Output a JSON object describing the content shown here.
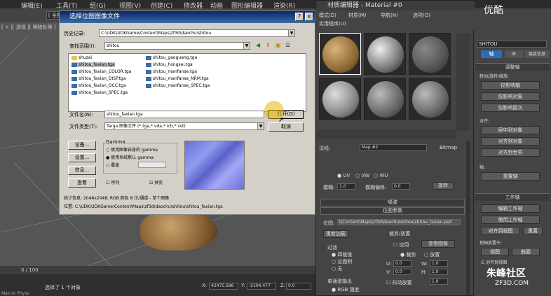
{
  "menubar": {
    "items": [
      "编辑(E)",
      "工具(T)",
      "组(G)",
      "视图(V)",
      "创建(C)",
      "修改器",
      "动画",
      "图形编辑器",
      "渲染(R)"
    ]
  },
  "viewport": {
    "label_top": "[ + ][ 透视 ][ 明暗处理 ]",
    "view_label": "[ 全部"
  },
  "timeline": {
    "frame": "0 / 100"
  },
  "status": {
    "selection": "选择了 1 个对象",
    "x": "42475.586",
    "y": "-2104.477",
    "z": "0.0",
    "prompt": "Max to Physx"
  },
  "file_dialog": {
    "title": "选择位图图像文件",
    "history_label": "历史记录:",
    "history_value": "C:\\UDK\\UDKGame\\Content\\Maps\\zf3d\\daochu\\shitou",
    "lookin_label": "查找范围(I):",
    "lookin_value": "shitou",
    "files_col1": [
      "shuzai",
      "shitou_faxian.tga",
      "shitou_faxian_COLOR.tga",
      "shitou_faxian_DISP.tga",
      "shitou_faxian_OCC.tga",
      "shitou_faxian_SPEC.tga"
    ],
    "files_col2": [
      "shitou_gaoguang.tga",
      "shitou_hongsei.tga",
      "shitou_manfanse.tga",
      "shitou_manfanse_NRM.tga",
      "shitou_manfanse_SPEC.tga"
    ],
    "filename_label": "文件名(N):",
    "filename_value": "shitou_faxian.tga",
    "filetype_label": "文件类型(T):",
    "filetype_value": "Targa 图像文件 (*.tga,*.vda,*.icb,*.vst)",
    "open_button": "打开(O)",
    "cancel_button": "取消",
    "setup_button": "设备...",
    "settings_button": "设置...",
    "info_button": "信息...",
    "view_button": "查看",
    "gamma_title": "Gamma",
    "gamma_own": "使用图像自身的 gamma",
    "gamma_system": "使用系统默认 gamma",
    "gamma_override": "覆盖",
    "sequence_label": "序列",
    "preview_label": "预览",
    "stats": "统计信息: 2048x2048, RGB 颜色 8 位/通道 - 单个图像",
    "location": "位置: C:\\UDK\\UDKGame\\Content\\Maps\\zf3d\\daochu\\shitou\\shitou_faxian.tga"
  },
  "material_editor": {
    "title": "材质编辑器 - Material #0",
    "menu": [
      "模式(D)",
      "材质(M)",
      "导航(N)",
      "选项(O)",
      "实用程序(U)"
    ],
    "map_label": "法线:",
    "map_value": "Map #2",
    "map_type": "Bitmap",
    "uvw": [
      "UV",
      "VW",
      "WU"
    ],
    "blur_label": "模糊:",
    "blur_value": "1.0",
    "blur_offset_label": "模糊偏移:",
    "blur_offset_value": "0.0",
    "rotate_button": "旋转",
    "noise_rollout": "噪波",
    "bitmap_rollout": "位图参数",
    "bitmap_label": "位图:",
    "bitmap_path": "t\\Content\\Maps\\zf3d\\daochu\\shitou\\shitou_faxian.psd",
    "reload_button": "重新加载",
    "crop_title": "裁剪/放置",
    "apply_label": "应用",
    "view_image_button": "查看图像",
    "crop_label": "裁剪",
    "place_label": "放置",
    "filter_title": "过滤",
    "filter_pyramidal": "四棱锥",
    "filter_summed": "总面积",
    "filter_none": "无",
    "u_label": "U:",
    "u_value": "0.0",
    "w_label": "W:",
    "w_value": "1.0",
    "v_label": "V:",
    "v_value": "0.0",
    "h_label": "H:",
    "h_value": "1.0",
    "jitter_label": "抖动放置",
    "jitter_value": "1.0",
    "mono_title": "单通道输出",
    "mono_rgb": "RGB 强度"
  },
  "right_panel": {
    "object_name": "SHITOU",
    "tab_axis": "轴",
    "tab_ik": "IK",
    "tab_link": "链接信息",
    "adjust_axis": "调整轴",
    "move_rotate": "移动/旋转/缩放:",
    "affect_pivot": "仅影响轴",
    "affect_object": "仅影响对象",
    "affect_hierarchy": "仅影响层次",
    "align": "对齐:",
    "center_object": "居中到对象",
    "align_object": "对齐到对象",
    "align_world": "对齐到世界",
    "pivot": "轴:",
    "reset_pivot": "重置轴",
    "working_pivot": "工作轴",
    "edit_working": "编辑工作轴",
    "use_working": "使用工作轴",
    "align_view": "对齐到视图",
    "reset": "重置",
    "place_pivot": "把轴放置于:",
    "view": "视图",
    "surface": "曲面",
    "align_to_view": "对齐到视图"
  },
  "watermark": {
    "text": "朱峰社区",
    "site": "ZF3D.COM",
    "brand": "优酷"
  },
  "colors": {
    "accent": "#0a246a",
    "dialog_bg": "#d4d0c8",
    "max_bg": "#444444",
    "highlight": "#e6b800"
  }
}
